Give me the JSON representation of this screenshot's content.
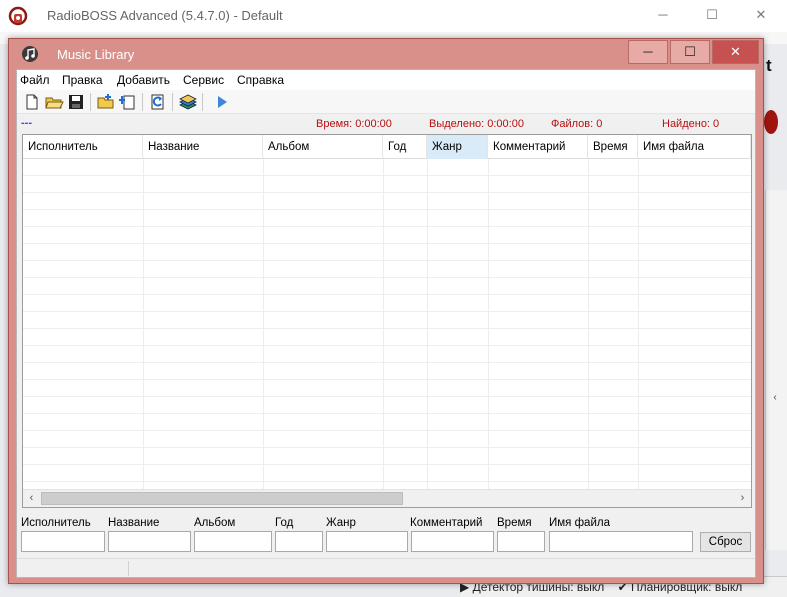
{
  "background_window": {
    "title": "RadioBOSS Advanced (5.4.7.0) - Default",
    "controls": {
      "minimize": "─",
      "maximize": "☐",
      "close": "✕"
    },
    "partial_letter": "t",
    "right_arrow": "‹",
    "status_items": [
      "▶ Детектор тишины: выкл",
      "✔ Планировщик: выкл"
    ],
    "colors": {
      "red_accent": "#a0150f"
    }
  },
  "window": {
    "title": "Music Library",
    "controls": {
      "minimize": "─",
      "maximize": "☐",
      "close": "✕"
    },
    "colors": {
      "frame": "#d9908a",
      "close": "#c75050"
    }
  },
  "menu": [
    "Файл",
    "Правка",
    "Добавить",
    "Сервис",
    "Справка"
  ],
  "toolbar": {
    "buttons": [
      {
        "name": "new-icon",
        "icon": "new-file"
      },
      {
        "name": "open-folder-icon",
        "icon": "open-folder"
      },
      {
        "name": "save-icon",
        "icon": "floppy-disk"
      },
      {
        "name": "add-folder-icon",
        "icon": "folder-plus"
      },
      {
        "name": "add-files-icon",
        "icon": "files-plus"
      },
      {
        "name": "refresh-icon",
        "icon": "refresh"
      },
      {
        "name": "library-icon",
        "icon": "books"
      },
      {
        "name": "play-icon",
        "icon": "play"
      }
    ]
  },
  "info": {
    "dash": "---",
    "time": "Время: 0:00:00",
    "selected": "Выделено: 0:00:00",
    "files": "Файлов: 0",
    "found": "Найдено: 0"
  },
  "grid": {
    "columns": [
      "Исполнитель",
      "Название",
      "Альбом",
      "Год",
      "Жанр",
      "Комментарий",
      "Время",
      "Имя файла"
    ],
    "sorted_column": "Жанр",
    "rows": [],
    "scroll_left": "‹",
    "scroll_right": "›"
  },
  "filters": {
    "labels": [
      "Исполнитель",
      "Название",
      "Альбом",
      "Год",
      "Жанр",
      "Комментарий",
      "Время",
      "Имя файла"
    ],
    "values": [
      "",
      "",
      "",
      "",
      "",
      "",
      "",
      ""
    ],
    "reset_label": "Сброс"
  }
}
